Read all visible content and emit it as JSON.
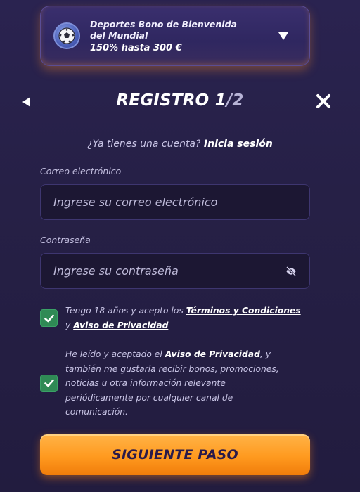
{
  "bonus": {
    "title": "Deportes Bono de Bienvenida del Mundial",
    "amount": "150% hasta 300 €",
    "icon": "soccer-ball-icon"
  },
  "header": {
    "title_main": "REGISTRO 1",
    "title_sep": "/",
    "title_total": "2"
  },
  "login": {
    "prompt": "¿Ya tienes una cuenta?",
    "link": "Inicia sesión"
  },
  "email": {
    "label": "Correo electrónico",
    "placeholder": "Ingrese su correo electrónico",
    "value": ""
  },
  "password": {
    "label": "Contraseña",
    "placeholder": "Ingrese su contraseña",
    "value": "",
    "icon": "eye-off-icon"
  },
  "consent_terms": {
    "checked": true,
    "text_before": "Tengo 18 años y acepto los ",
    "link_terms": "Términos y Condiciones",
    "text_mid": "y ",
    "link_privacy": "Aviso de Privacidad"
  },
  "consent_marketing": {
    "checked": true,
    "text_before": "He leído y aceptado el ",
    "link_privacy": "Aviso de Privacidad",
    "text_after": ", y también me gustaría recibir bonos, promociones, noticias u otra información relevante periódicamente por cualquier canal de comunicación."
  },
  "next_button": {
    "label": "SIGUIENTE PASO"
  },
  "colors": {
    "accent_orange": "#ff9a1f",
    "check_green": "#2f8a55",
    "background": "#262046"
  }
}
